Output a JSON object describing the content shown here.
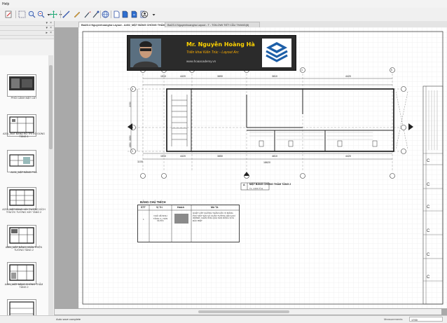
{
  "menu": {
    "label": "Help"
  },
  "toolbar": {
    "groups": [
      [
        "edit-icon",
        "select-icon"
      ],
      [
        "zoom-icon",
        "zoom-extents-icon",
        "dropdown-icon",
        "pan-icon",
        "settings-icon"
      ],
      [
        "line-icon",
        "pen-icon",
        "brush-icon",
        "paint-icon"
      ],
      [
        "globe-icon"
      ],
      [
        "document-icon",
        "document-icon",
        "document-icon",
        "document-icon",
        "user-icon",
        "dropdown-icon"
      ]
    ]
  },
  "thumbnails": [
    {
      "label": "PHỐI CẢNH MẶT CẮT"
    },
    {
      "label": "A201_MẶT BẰNG BỐ TRÍ ĐỒ DÙNG TẦNG 1"
    },
    {
      "label": "A101_MẶT BẰNG PHÁ"
    },
    {
      "label": "A201_MẶT BẰNG XÂY TƯỜNG KÍCH THƯỚC TƯỜNG XÂY TẦNG 2"
    },
    {
      "label": "A301_MẶT BẰNG HOÀN THIỆN TƯỜNG TẦNG 2"
    },
    {
      "label": "A401_MẶT BẰNG CHỐNG THẤM TẦNG 2"
    }
  ],
  "tabs": [
    {
      "label": "Bai23.4 Nguyenhoangha Layout - A402_MẶT BẰNG CHỐNG THẤM TẦNG 2",
      "active": true
    },
    {
      "label": "Bai23.4 Nguyenhoangha Layout - T - TOILOWI TIẾT CẦU THANG(8)",
      "active": false
    }
  ],
  "banner": {
    "name": "Mr. Nguyễn Hoàng Hà",
    "subtitle": "Triển khai Kiến Trúc - Layout Arc",
    "url": "www.hoaacademy.vn"
  },
  "plan": {
    "title": "MẶT BẰNG CHỐNG THẤM TẦNG 2",
    "scale": "TL: 1/100 Tỉ lệ",
    "grid_letters": [
      "A",
      "B",
      "C"
    ],
    "grid_numbers": [
      "1",
      "2",
      "3",
      "4",
      "5"
    ],
    "top_dims": [
      "1510",
      "4420",
      "3890",
      "3810",
      "4420"
    ],
    "bottom_dims": [
      "1510",
      "4420",
      "3850",
      "4810",
      "4420"
    ],
    "overall": "18620",
    "left_dims": [
      "2050",
      "3350",
      "1550"
    ],
    "edge_dim": "1100",
    "top_left_dim": "400"
  },
  "legend": {
    "title": "BẢNG CHÚ THÍCH",
    "headers": [
      "STT",
      "Vị Trí",
      "Hatch",
      "Mô Tả"
    ],
    "row": {
      "stt": "1",
      "location": "NHÀ VỆ SINH TẦNG 2 + SÀN NƯỚC",
      "description": "QUÉT LỚP CHỐNG THẤM GỐC XI MĂNG PHỦ MẶT SÀN VÀ CHÂN TƯỜNG LÊN CAO 300MM, CHÂN ỐNG QUA SÀN DÙNG VỮA ĐẶC BIỆT"
    }
  },
  "status": {
    "text": "Auto save complete",
    "measurements_label": "Measurements",
    "measurements_value": "1700"
  }
}
